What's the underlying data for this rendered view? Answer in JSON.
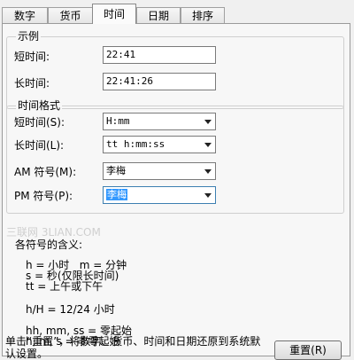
{
  "tabs": [
    {
      "label": "数字"
    },
    {
      "label": "货币"
    },
    {
      "label": "时间"
    },
    {
      "label": "日期"
    },
    {
      "label": "排序"
    }
  ],
  "examples": {
    "legend": "示例",
    "short_label": "短时间:",
    "short_value": "22:41",
    "long_label": "长时间:",
    "long_value": "22:41:26"
  },
  "formats": {
    "legend": "时间格式",
    "short_label": "短时间(S):",
    "short_value": "H:mm",
    "long_label": "长时间(L):",
    "long_value": "tt h:mm:ss",
    "am_label": "AM 符号(M):",
    "am_value": "李梅",
    "pm_label": "PM 符号(P):",
    "pm_value": "李梅"
  },
  "watermark": "三联网 3LIAN.COM",
  "help": {
    "title": "各符号的含义:",
    "line1": "h = 小时   m = 分钟",
    "line2": "s = 秒(仅限长时间)",
    "line3": "tt = 上午或下午",
    "line4": "h/H = 12/24 小时",
    "line5": "hh, mm, ss = 零起始",
    "line6": "h, m, s = 非零起始"
  },
  "footer_text": "单击“重置”，将数字、货币、时间和日期还原到系统默认设置。",
  "reset_label": "重置(R)"
}
